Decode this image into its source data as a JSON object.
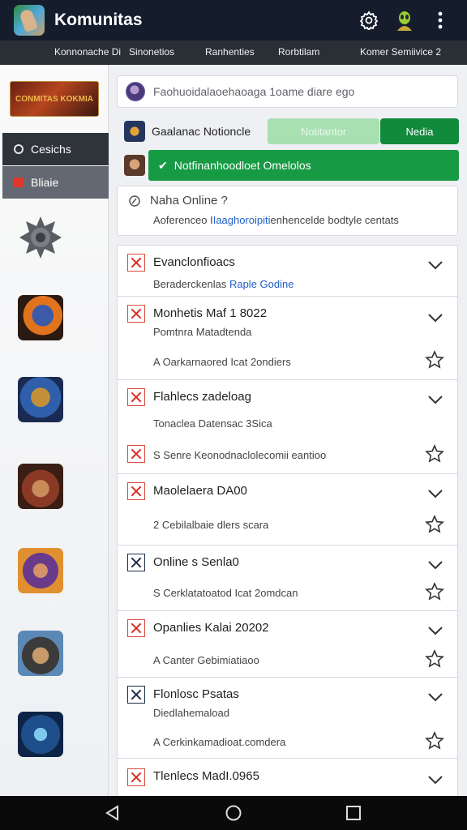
{
  "app": {
    "title": "Komunitas"
  },
  "appbar": {
    "icons": [
      "settings-gear-icon",
      "alien-profile-icon",
      "overflow-menu-icon"
    ]
  },
  "tabs": [
    "Konnonache Di",
    "Sinonetios",
    "Ranhenties",
    "Rorbtilam",
    "Komer Semiivice 2"
  ],
  "sidebar": {
    "banner_text": "Conmitas Kokmia",
    "nav": [
      {
        "label": "Cesichs",
        "icon": "circle-icon"
      },
      {
        "label": "Bliaie",
        "icon": "flag-icon"
      }
    ],
    "games": [
      "gear-game-icon",
      "fire-warrior-game-icon",
      "horned-warrior-game-icon",
      "helmet-soldier-game-icon",
      "sorceress-game-icon",
      "cowboy-hat-game-icon",
      "blue-knight-game-icon"
    ]
  },
  "search": {
    "text": "Faohuoidalaoehaoaga 1oame diare ego"
  },
  "notif_row": {
    "label": "Gaalanac Notioncle",
    "button_light": "Notitantor",
    "button_green": "Nedia"
  },
  "banner": {
    "text": "Notfinanhoodloet Omelolos"
  },
  "online_card": {
    "title": "Naha Online ?",
    "line_prefix": "Aoferenceo I",
    "line_link": "Iaaghoroipiti",
    "line_suffix": "enhencelde bodtyle centats"
  },
  "list": [
    {
      "title": "Evanclonfioacs",
      "sub": "Beraderckenlas",
      "sub_link": "Raple Godine",
      "foot": "",
      "icon": "x-mark-icon",
      "star": false
    },
    {
      "title": "Monhetis Maf 1 8022",
      "sub": "Pomtnra Matadtenda",
      "foot": "A Oarkarnaored Icat 2ondiers",
      "icon": "x-mark-icon",
      "star": true
    },
    {
      "title": "Flahlecs zadeloag",
      "sub": "Tonaclea Datensac 3Sica",
      "foot": "",
      "icon": "x-mark-icon",
      "star": false
    },
    {
      "title": "",
      "sub": "",
      "foot": "S Senre Keonodnaclolecomii eantioo",
      "icon": "x-mark-icon",
      "star": true
    },
    {
      "title": "Maolelaera DA00",
      "sub": "",
      "foot": "2 Cebilalbaie dlers scara",
      "icon": "x-mark-icon",
      "star": true
    },
    {
      "title": "Online s Senla0",
      "sub": "",
      "foot": "S Cerklatatoatod Icat 2omdcan",
      "icon": "x-mark-dark-icon",
      "star": true
    },
    {
      "title": "Opanlies Kalai 20202",
      "sub": "",
      "foot": "A Canter Gebimiatiaoo",
      "icon": "x-mark-icon",
      "star": true
    },
    {
      "title": "Flonlosc Psatas",
      "sub": "Diedlahemaload",
      "foot": "A Cerkinkamadioat.comdera",
      "icon": "x-mark-dark-icon",
      "star": true
    },
    {
      "title": "Tlenlecs MadI.0965",
      "sub": "",
      "foot": "",
      "icon": "x-mark-icon",
      "star": false
    }
  ],
  "navbar": {
    "icons": [
      "back-icon",
      "home-icon",
      "recents-icon"
    ]
  },
  "colors": {
    "appbar": "#151d2c",
    "accent_green": "#128a3b",
    "link_blue": "#1f5fc7",
    "danger_red": "#d82e20"
  }
}
